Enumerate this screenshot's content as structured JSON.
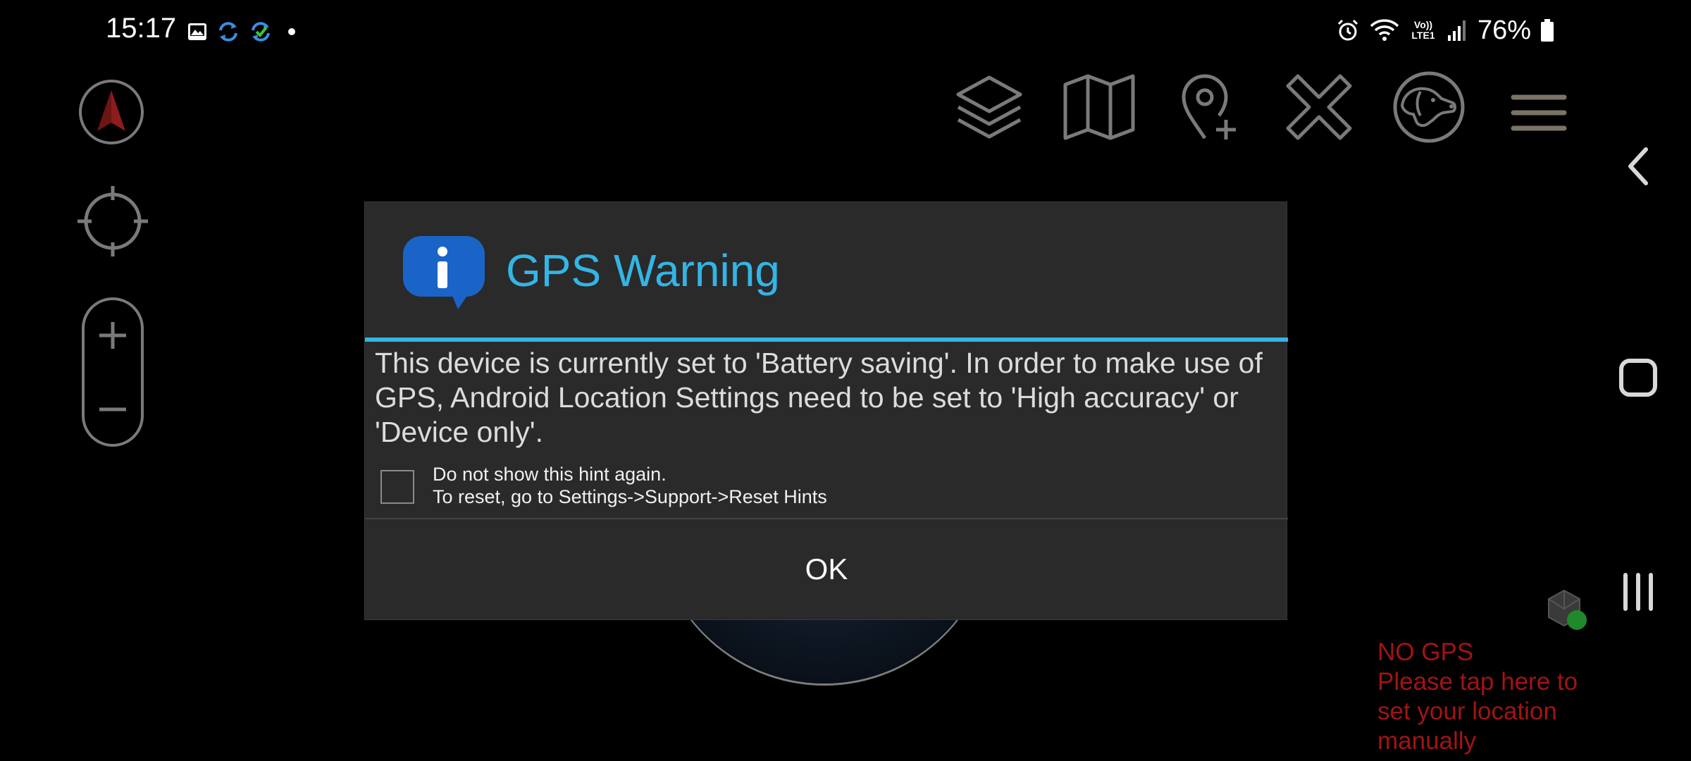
{
  "status_bar": {
    "time": "15:17",
    "left_icons": [
      "image-icon",
      "sync-icon",
      "sync-green-icon",
      "dot-icon"
    ],
    "right_icons": [
      "alarm-icon",
      "wifi-icon",
      "volte-icon",
      "signal-icon",
      "battery-icon"
    ],
    "volte_label": "Vo)) LTE1",
    "battery_percent": "76%"
  },
  "left_controls": {
    "compass_icon": "compass-arrow-icon",
    "locate_icon": "crosshair-icon",
    "zoom_in_icon": "plus-icon",
    "zoom_out_icon": "minus-icon"
  },
  "toolbar": {
    "icons": [
      "layers-icon",
      "map-icon",
      "add-location-pin-icon",
      "close-x-icon",
      "dog-icon",
      "menu-icon"
    ]
  },
  "nav_bar": {
    "icons": [
      "back-chevron-icon",
      "home-square-icon",
      "recents-icon"
    ]
  },
  "dialog": {
    "title": "GPS Warning",
    "title_color": "#33b5e5",
    "message": "This device is currently set to 'Battery saving'. In order to make use of GPS, Android Location Settings need to be set to 'High accuracy' or 'Device only'.",
    "hint_line1": "Do not show this hint again.",
    "hint_line2": "To reset, go to Settings->Support->Reset Hints",
    "hint_checked": false,
    "ok_label": "OK"
  },
  "no_gps": {
    "line1": "NO GPS",
    "line2": "Please tap here to set your location manually",
    "color": "#a11414"
  }
}
